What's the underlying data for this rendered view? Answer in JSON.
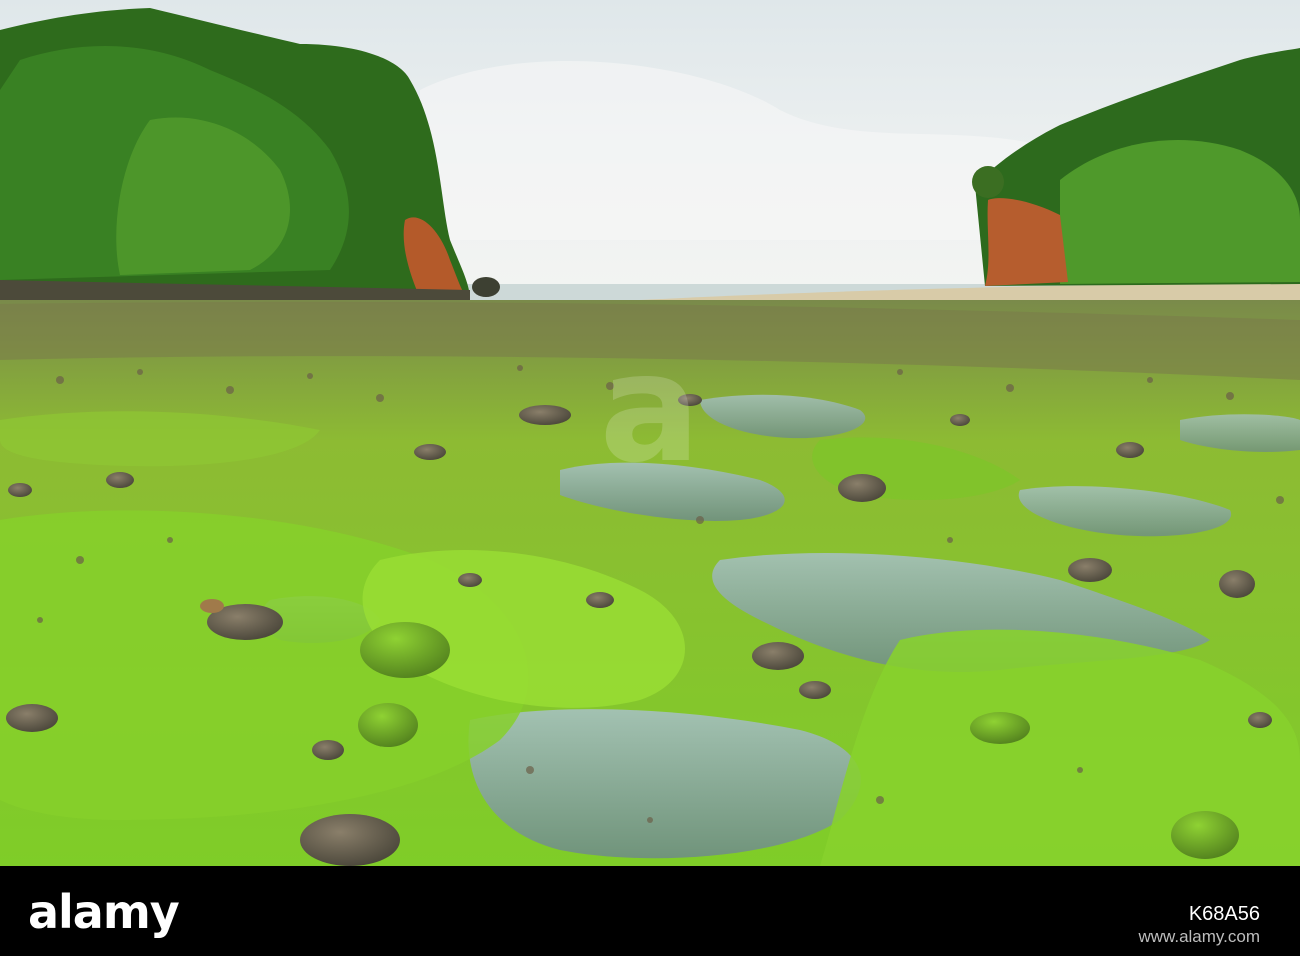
{
  "photo": {
    "description_label": "",
    "palette": {
      "sky": "#e8ecee",
      "forest": "#2f6b1f",
      "cliff": "#b45a2a",
      "sand": "#d6c9a6",
      "sea": "#c9d7d6",
      "algae": "#8bcf2a",
      "pool": "#7fa7a2",
      "rock": "#5d5a4a"
    }
  },
  "watermark": {
    "text": "a"
  },
  "footer": {
    "logo": "alamy",
    "image_id": "K68A56",
    "site": "www.alamy.com"
  }
}
